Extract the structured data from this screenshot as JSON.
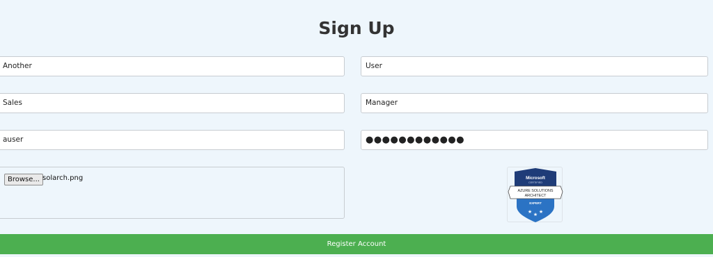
{
  "form": {
    "title": "Sign Up",
    "first_name": "Another",
    "last_name": "User",
    "department": "Sales",
    "role": "Manager",
    "username": "auser",
    "password_mask": "●●●●●●●●●●●●",
    "browse_label": "Browse...",
    "file_name": "solarch.png",
    "register_label": "Register Account"
  },
  "badge": {
    "line1": "Microsoft",
    "line2": "CERTIFIED",
    "line3": "AZURE SOLUTIONS",
    "line4": "ARCHITECT",
    "line5": "EXPERT",
    "icon": "certification-badge-icon"
  },
  "colors": {
    "background": "#eef6fc",
    "register_button": "#4caf50",
    "badge_navy": "#1f3c78",
    "badge_blue": "#2b73c4"
  }
}
